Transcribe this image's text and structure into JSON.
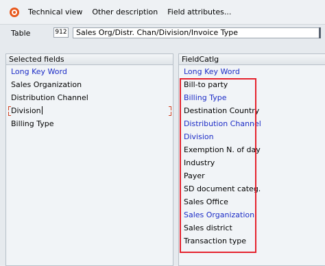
{
  "toolbar": {
    "technical_view": "Technical view",
    "other_description": "Other description",
    "field_attributes": "Field attributes..."
  },
  "table": {
    "label": "Table",
    "code": "912",
    "description": "Sales Org/Distr. Chan/Division/Invoice Type"
  },
  "selected_fields": {
    "header": "Selected fields",
    "items": [
      {
        "label": "Long Key Word",
        "style": "blue"
      },
      {
        "label": "Sales Organization",
        "style": "normal"
      },
      {
        "label": "Distribution Channel",
        "style": "normal"
      },
      {
        "label": "Division",
        "style": "normal"
      },
      {
        "label": "Billing Type",
        "style": "normal"
      }
    ]
  },
  "field_catalog": {
    "header": "FieldCatlg",
    "items": [
      {
        "label": "Long Key Word",
        "style": "blue"
      },
      {
        "label": "Bill-to party",
        "style": "normal"
      },
      {
        "label": "Billing Type",
        "style": "blue"
      },
      {
        "label": "Destination Country",
        "style": "normal"
      },
      {
        "label": "Distribution Channel",
        "style": "blue"
      },
      {
        "label": "Division",
        "style": "blue"
      },
      {
        "label": "Exemption N. of day",
        "style": "normal"
      },
      {
        "label": "Industry",
        "style": "normal"
      },
      {
        "label": "Payer",
        "style": "normal"
      },
      {
        "label": "SD document categ.",
        "style": "normal"
      },
      {
        "label": "Sales Office",
        "style": "normal"
      },
      {
        "label": "Sales Organization",
        "style": "blue"
      },
      {
        "label": "Sales district",
        "style": "normal"
      },
      {
        "label": "Transaction type",
        "style": "normal"
      }
    ]
  },
  "colors": {
    "link_blue": "#1b2bc6",
    "highlight_red": "#e5212c",
    "toolbar_icon": "#e8581c"
  }
}
